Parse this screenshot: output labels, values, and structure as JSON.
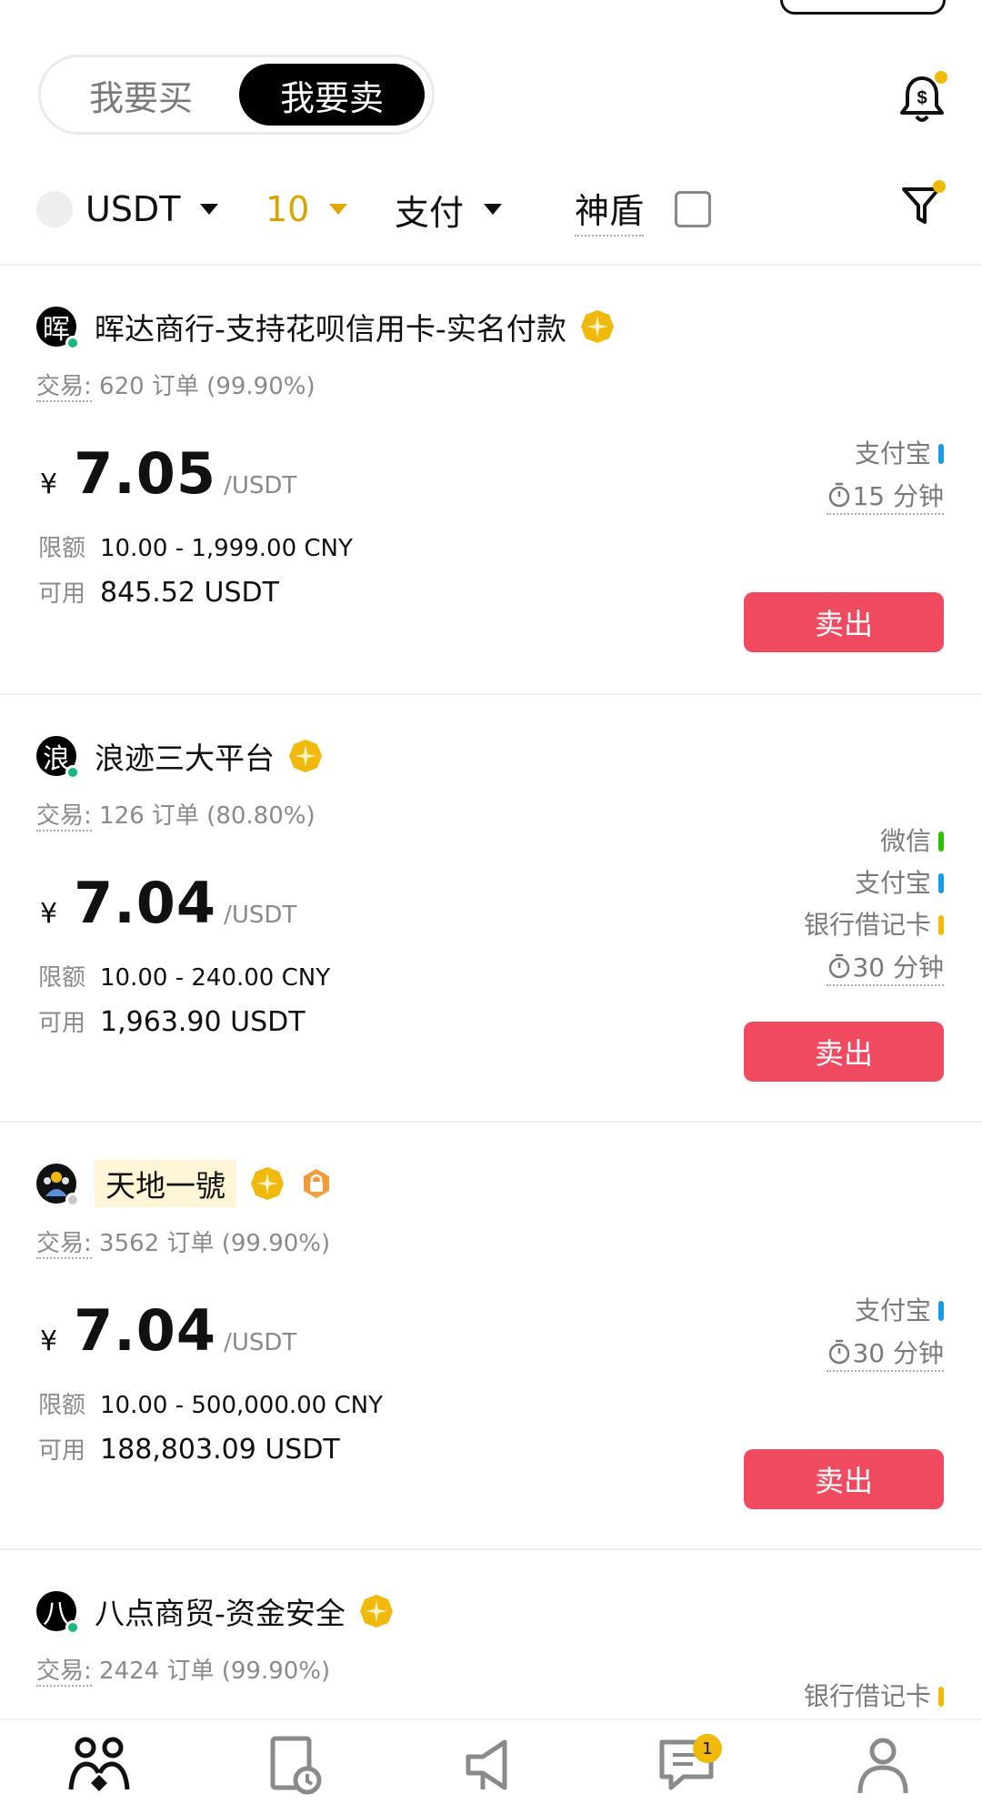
{
  "tabs": {
    "buy": "我要买",
    "sell": "我要卖"
  },
  "filters": {
    "coin": "USDT",
    "amount": "10",
    "payment": "支付",
    "shield": "神盾"
  },
  "colors": {
    "accent": "#F0B90B",
    "sell_button": "#F04A61",
    "online": "#19B87A",
    "alipay": "#1A9BE8",
    "wechat": "#2DC100",
    "bank": "#F0B90B"
  },
  "ads": [
    {
      "avatar": "晖",
      "merchant": "晖达商行-支持花呗信用卡-实名付款",
      "online": true,
      "trade_label": "交易:",
      "trade_stats": "620 订单 (99.90%)",
      "yen": "¥",
      "price": "7.05",
      "unit": "/USDT",
      "limit_label": "限额",
      "limit": "10.00 - 1,999.00 CNY",
      "avail_label": "可用",
      "avail": "845.52 USDT",
      "payments": [
        {
          "name": "支付宝",
          "color": "#1A9BE8"
        }
      ],
      "time": "15 分钟",
      "action": "卖出"
    },
    {
      "avatar": "浪",
      "merchant": "浪迹三大平台",
      "online": true,
      "trade_label": "交易:",
      "trade_stats": "126 订单 (80.80%)",
      "yen": "¥",
      "price": "7.04",
      "unit": "/USDT",
      "limit_label": "限额",
      "limit": "10.00 - 240.00 CNY",
      "avail_label": "可用",
      "avail": "1,963.90 USDT",
      "payments": [
        {
          "name": "微信",
          "color": "#2DC100"
        },
        {
          "name": "支付宝",
          "color": "#1A9BE8"
        },
        {
          "name": "银行借记卡",
          "color": "#F0B90B"
        }
      ],
      "time": "30 分钟",
      "action": "卖出"
    },
    {
      "avatar": "",
      "merchant": "天地一號",
      "online": false,
      "trade_label": "交易:",
      "trade_stats": "3562 订单 (99.90%)",
      "yen": "¥",
      "price": "7.04",
      "unit": "/USDT",
      "limit_label": "限额",
      "limit": "10.00 - 500,000.00 CNY",
      "avail_label": "可用",
      "avail": "188,803.09 USDT",
      "payments": [
        {
          "name": "支付宝",
          "color": "#1A9BE8"
        }
      ],
      "time": "30 分钟",
      "action": "卖出"
    },
    {
      "avatar": "八",
      "merchant": "八点商贸-资金安全",
      "online": true,
      "trade_label": "交易:",
      "trade_stats": "2424 订单 (99.90%)",
      "payments": [
        {
          "name": "银行借记卡",
          "color": "#F0B90B"
        }
      ]
    }
  ],
  "nav": {
    "items": [
      "p2p-icon",
      "orders-icon",
      "ads-icon",
      "chat-icon",
      "profile-icon"
    ],
    "chat_badge": "1"
  }
}
